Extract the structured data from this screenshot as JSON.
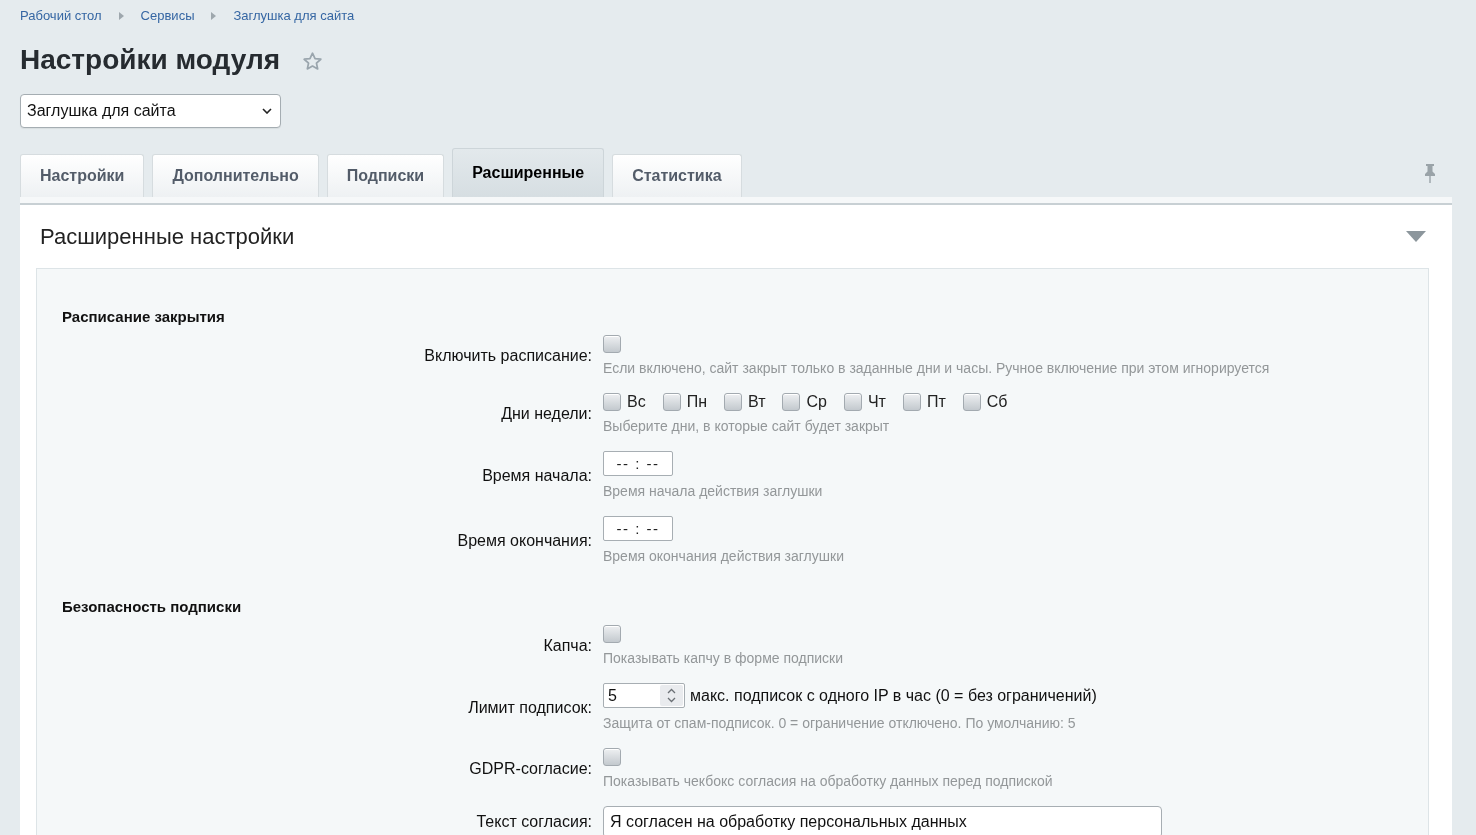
{
  "breadcrumbs": [
    "Рабочий стол",
    "Сервисы",
    "Заглушка для сайта"
  ],
  "page_title": "Настройки модуля",
  "favorite": false,
  "module_select": {
    "value": "Заглушка для сайта"
  },
  "tabs": [
    {
      "label": "Настройки",
      "selected": false
    },
    {
      "label": "Дополнительно",
      "selected": false
    },
    {
      "label": "Подписки",
      "selected": false
    },
    {
      "label": "Расширенные",
      "selected": true
    },
    {
      "label": "Статистика",
      "selected": false
    }
  ],
  "panel": {
    "title": "Расширенные настройки",
    "expanded": true,
    "sections": [
      {
        "title": "Расписание закрытия",
        "rows": [
          {
            "kind": "checkbox",
            "label": "Включить расписание:",
            "checked": false,
            "hint": "Если включено, сайт закрыт только в заданные дни и часы. Ручное включение при этом игнорируется"
          },
          {
            "kind": "days",
            "label": "Дни недели:",
            "days": [
              {
                "label": "Вс",
                "checked": false
              },
              {
                "label": "Пн",
                "checked": false
              },
              {
                "label": "Вт",
                "checked": false
              },
              {
                "label": "Ср",
                "checked": false
              },
              {
                "label": "Чт",
                "checked": false
              },
              {
                "label": "Пт",
                "checked": false
              },
              {
                "label": "Сб",
                "checked": false
              }
            ],
            "hint": "Выберите дни, в которые сайт будет закрыт"
          },
          {
            "kind": "time",
            "label": "Время начала:",
            "placeholder": "-- : --",
            "hint": "Время начала действия заглушки"
          },
          {
            "kind": "time",
            "label": "Время окончания:",
            "placeholder": "-- : --",
            "hint": "Время окончания действия заглушки"
          }
        ]
      },
      {
        "title": "Безопасность подписки",
        "rows": [
          {
            "kind": "checkbox",
            "label": "Капча:",
            "checked": false,
            "hint": "Показывать капчу в форме подписки"
          },
          {
            "kind": "number",
            "label": "Лимит подписок:",
            "value": "5",
            "suffix": "макс. подписок с одного IP в час (0 = без ограничений)",
            "hint": "Защита от спам-подписок. 0 = ограничение отключено. По умолчанию: 5"
          },
          {
            "kind": "checkbox",
            "label": "GDPR-согласие:",
            "checked": false,
            "hint": "Показывать чекбокс согласия на обработку данных перед подпиской"
          },
          {
            "kind": "text",
            "label": "Текст согласия:",
            "value": "Я согласен на обработку персональных данных"
          }
        ]
      }
    ]
  }
}
